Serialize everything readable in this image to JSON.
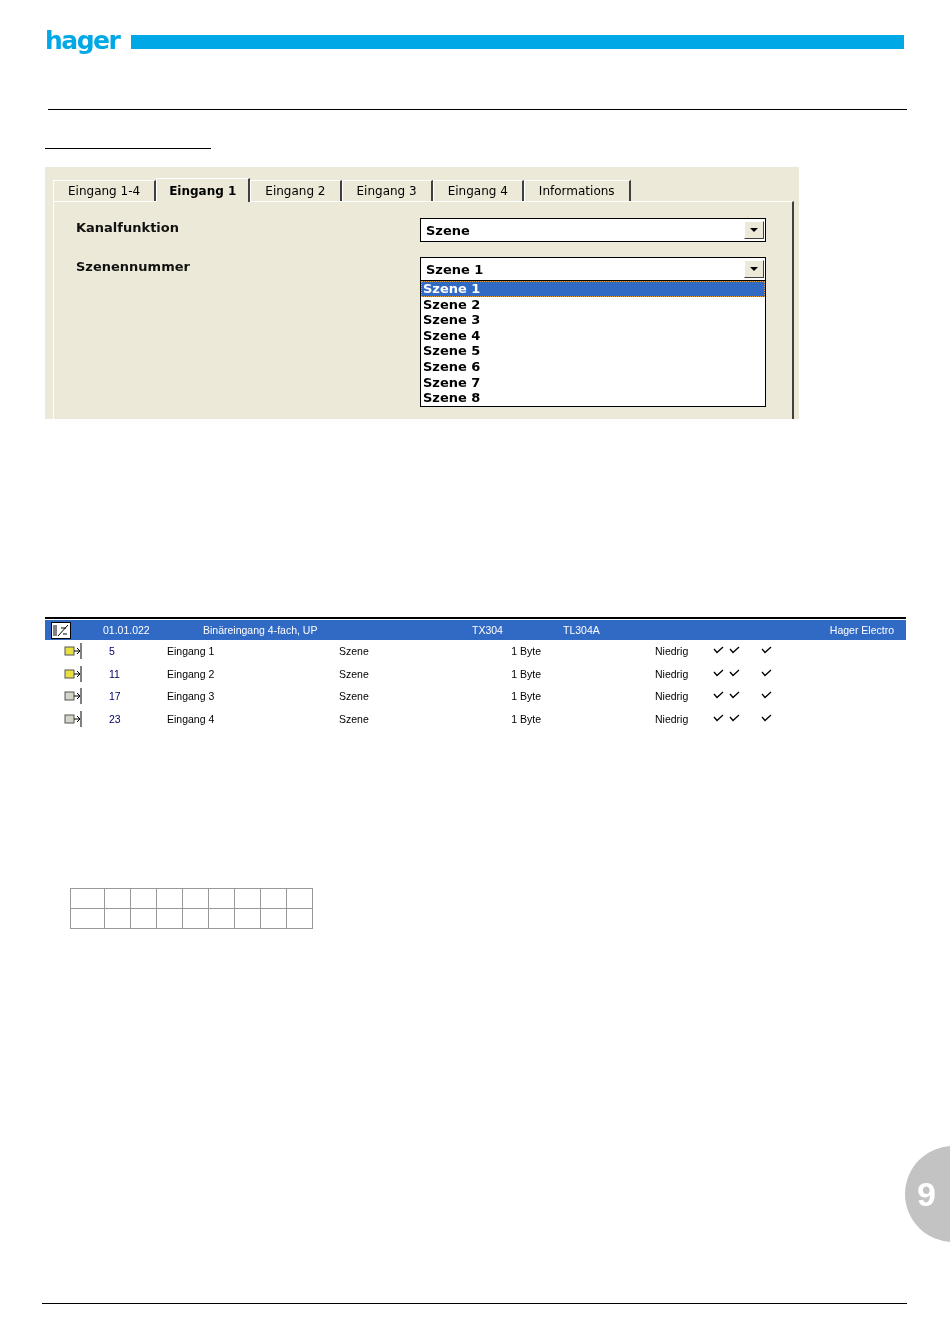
{
  "header": {
    "logo": "hager"
  },
  "dialog": {
    "tabs": [
      {
        "label": "Eingang 1-4",
        "selected": false
      },
      {
        "label": "Eingang 1",
        "selected": true
      },
      {
        "label": "Eingang 2",
        "selected": false
      },
      {
        "label": "Eingang 3",
        "selected": false
      },
      {
        "label": "Eingang 4",
        "selected": false
      },
      {
        "label": "Informations",
        "selected": false
      }
    ],
    "params": [
      {
        "label": "Kanalfunktion",
        "value": "Szene",
        "expanded": false
      },
      {
        "label": "Szenennummer",
        "value": "Szene 1",
        "expanded": true,
        "options": [
          {
            "label": "Szene 1",
            "selected": true
          },
          {
            "label": "Szene 2",
            "selected": false
          },
          {
            "label": "Szene 3",
            "selected": false
          },
          {
            "label": "Szene 4",
            "selected": false
          },
          {
            "label": "Szene 5",
            "selected": false
          },
          {
            "label": "Szene 6",
            "selected": false
          },
          {
            "label": "Szene 7",
            "selected": false
          },
          {
            "label": "Szene 8",
            "selected": false
          }
        ]
      }
    ]
  },
  "device_table": {
    "device": {
      "address": "01.01.022",
      "name": "Binäreingang 4-fach, UP",
      "column_3": "TX304",
      "column_4": "TL304A",
      "manufacturer": "Hager Electro"
    },
    "rows": [
      {
        "number": "5",
        "name": "Eingang 1",
        "function": "Szene",
        "size": "1 Byte",
        "priority": "Niedrig",
        "color": "#e8e040",
        "flags": [
          true,
          true,
          false,
          true
        ]
      },
      {
        "number": "11",
        "name": "Eingang 2",
        "function": "Szene",
        "size": "1 Byte",
        "priority": "Niedrig",
        "color": "#e8e040",
        "flags": [
          true,
          true,
          false,
          true
        ]
      },
      {
        "number": "17",
        "name": "Eingang 3",
        "function": "Szene",
        "size": "1 Byte",
        "priority": "Niedrig",
        "color": "#d4d4c8",
        "flags": [
          true,
          true,
          false,
          true
        ]
      },
      {
        "number": "23",
        "name": "Eingang 4",
        "function": "Szene",
        "size": "1 Byte",
        "priority": "Niedrig",
        "color": "#d4d4c8",
        "flags": [
          true,
          true,
          false,
          true
        ]
      }
    ]
  },
  "page_number": "9"
}
